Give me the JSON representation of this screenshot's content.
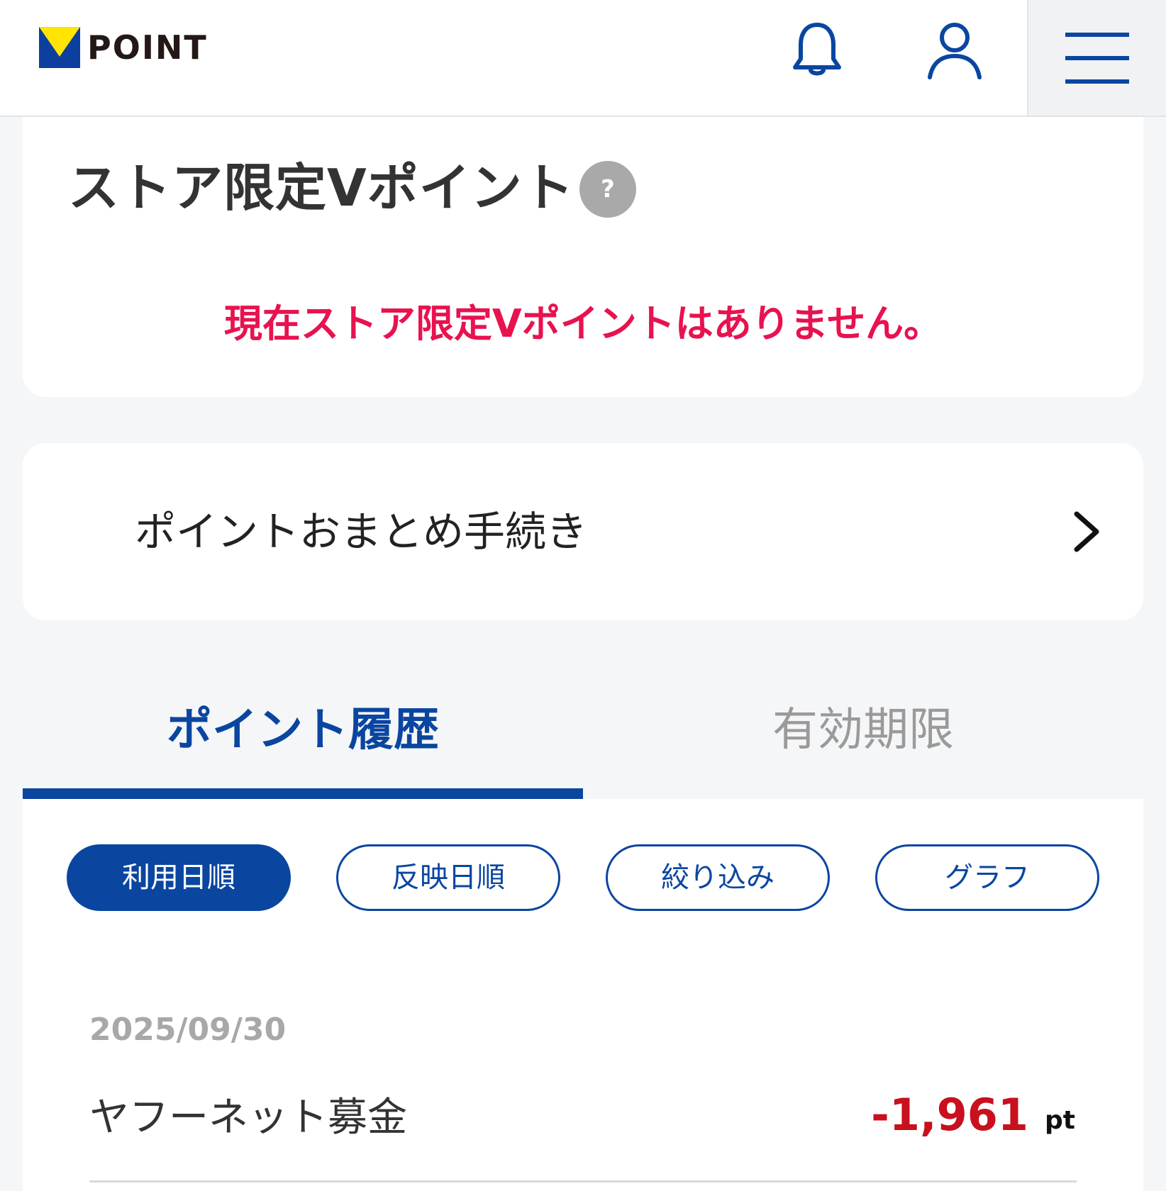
{
  "header": {
    "logo_text": "POINT",
    "icons": {
      "bell": "bell-icon",
      "user": "user-icon",
      "menu": "hamburger-menu-icon"
    },
    "accent_color": "#0a46a0",
    "logo_colors": {
      "blue": "#0c3f9e",
      "yellow": "#ffe500"
    }
  },
  "store_points": {
    "title": "ストア限定Vポイント",
    "help_label": "?",
    "empty_message": "現在ストア限定Vポイントはありません。",
    "empty_message_color": "#e8124f"
  },
  "merge_link": {
    "label": "ポイントおまとめ手続き",
    "icon": "chevron-right-icon"
  },
  "tabs": [
    {
      "label": "ポイント履歴",
      "active": true
    },
    {
      "label": "有効期限",
      "active": false
    }
  ],
  "filters": [
    {
      "label": "利用日順",
      "active": true
    },
    {
      "label": "反映日順",
      "active": false
    },
    {
      "label": "絞り込み",
      "active": false
    },
    {
      "label": "グラフ",
      "active": false
    }
  ],
  "history": [
    {
      "date": "2025/09/30",
      "name": "ヤフーネット募金",
      "amount": "-1,961",
      "unit": "pt",
      "amount_color": "#c8101e"
    }
  ]
}
